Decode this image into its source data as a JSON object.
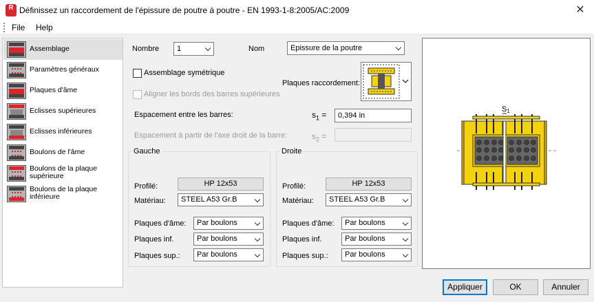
{
  "window": {
    "title": "Définissez un raccordement de l'épissure de poutre à poutre - EN 1993-1-8:2005/AC:2009",
    "app_icon_text": "R"
  },
  "menu": {
    "items": [
      "File",
      "Help"
    ]
  },
  "sidebar": {
    "items": [
      {
        "label": "Assemblage",
        "icon": "assembly-icon",
        "selected": true
      },
      {
        "label": "Paramètres généraux",
        "icon": "general-params-icon"
      },
      {
        "label": "Plaques d'âme",
        "icon": "web-plates-icon"
      },
      {
        "label": "Eclisses supérieures",
        "icon": "top-splice-icon"
      },
      {
        "label": "Eclisses inférieures",
        "icon": "bottom-splice-icon"
      },
      {
        "label": "Boulons de l'âme",
        "icon": "web-bolts-icon"
      },
      {
        "label": "Boulons de la plaque supérieure",
        "icon": "top-plate-bolts-icon"
      },
      {
        "label": "Boulons de la plaque inférieure",
        "icon": "bottom-plate-bolts-icon"
      }
    ]
  },
  "form": {
    "nombre_label": "Nombre",
    "nombre_value": "1",
    "nom_label": "Nom",
    "nom_value": "Epissure de la poutre",
    "symmetric_label": "Assemblage symétrique",
    "align_label": "Aligner les bords des barres supérieures",
    "plaques_raccordement_label": "Plaques raccordement:",
    "espacement_label": "Espacement entre les barres:",
    "s1_label": "s",
    "s1_sub": "1",
    "eq": "=",
    "s1_value": "0,394 in",
    "espacement_axe_label": "Espacement à partir de l'axe droit de la barre:",
    "s2_label": "s",
    "s2_sub": "2",
    "s2_value": ""
  },
  "gauche": {
    "title": "Gauche",
    "profile_label": "Profilé:",
    "profile_value": "HP 12x53",
    "material_label": "Matériau:",
    "material_value": "STEEL A53 Gr.B",
    "web_plates_label": "Plaques d'âme:",
    "web_plates_value": "Par boulons",
    "inf_plates_label": "Plaques inf.",
    "inf_plates_value": "Par boulons",
    "sup_plates_label": "Plaques sup.:",
    "sup_plates_value": "Par boulons"
  },
  "droite": {
    "title": "Droite",
    "profile_label": "Profilé:",
    "profile_value": "HP 12x53",
    "material_label": "Matériau:",
    "material_value": "STEEL A53 Gr.B",
    "web_plates_label": "Plaques d'âme:",
    "web_plates_value": "Par boulons",
    "inf_plates_label": "Plaques inf.",
    "inf_plates_value": "Par boulons",
    "sup_plates_label": "Plaques sup.:",
    "sup_plates_value": "Par boulons"
  },
  "preview": {
    "s1_label": "S",
    "s1_sub": "1"
  },
  "buttons": {
    "apply": "Appliquer",
    "ok": "OK",
    "cancel": "Annuler"
  },
  "colors": {
    "plate": "#f5d20f",
    "beam": "#4a4a4a",
    "accent": "#0078d7",
    "brand": "#d9262c"
  }
}
